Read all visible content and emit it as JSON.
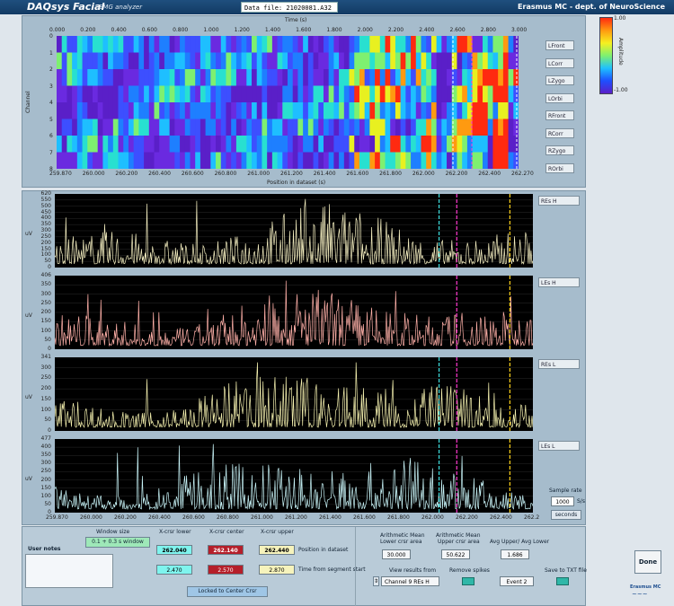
{
  "titlebar": {
    "app_title": "DAQsys Facial",
    "app_subtitle": "EMG analyzer",
    "data_file": "Data file: 21020081.A32",
    "org": "Erasmus MC - dept. of NeuroScience"
  },
  "heatmap": {
    "top_axis_title": "Time (s)",
    "top_ticks": [
      "0.000",
      "0.200",
      "0.400",
      "0.600",
      "0.800",
      "1.000",
      "1.200",
      "1.400",
      "1.600",
      "1.800",
      "2.000",
      "2.200",
      "2.400",
      "2.600",
      "2.800",
      "3.000"
    ],
    "bottom_axis_title": "Position in dataset (s)",
    "bottom_ticks": [
      "259.870",
      "260.000",
      "260.200",
      "260.400",
      "260.600",
      "260.800",
      "261.000",
      "261.200",
      "261.400",
      "261.600",
      "261.800",
      "262.000",
      "262.200",
      "262.400",
      "262.270"
    ],
    "y_axis_title": "Channel",
    "y_ticks": [
      "0",
      "1",
      "2",
      "3",
      "4",
      "5",
      "6",
      "7",
      "8"
    ],
    "channel_buttons": [
      "LFront",
      "LCorr",
      "LZygo",
      "LOrbi",
      "RFront",
      "RCorr",
      "RZygo",
      "ROrbi"
    ],
    "colorbar_max": "1.00",
    "colorbar_min": "-1.00",
    "colorbar_label": "Amplitude",
    "colors": {
      "low": "#5a1fc8",
      "mid": "#1e9fff",
      "high": "#ff2a10"
    }
  },
  "chart_data": [
    {
      "type": "line",
      "name_button": "REs H",
      "y_label": "uV",
      "ylim": [
        0,
        620
      ],
      "y_ticks": [
        "0",
        "50",
        "100",
        "150",
        "200",
        "250",
        "300",
        "350",
        "400",
        "450",
        "500",
        "550",
        "620"
      ],
      "color": "#f4eec0",
      "cursors": [
        {
          "x": 262.04,
          "color": "#3ee0e0"
        },
        {
          "x": 262.14,
          "color": "#ff3ad0"
        },
        {
          "x": 262.44,
          "color": "#ffd21a"
        }
      ]
    },
    {
      "type": "line",
      "name_button": "LEs H",
      "y_label": "uV",
      "ylim": [
        0,
        406
      ],
      "y_ticks": [
        "0",
        "50",
        "100",
        "150",
        "200",
        "250",
        "300",
        "350",
        "406"
      ],
      "color": "#ffb0a8",
      "cursors": [
        {
          "x": 262.14,
          "color": "#ff3ad0"
        },
        {
          "x": 262.44,
          "color": "#ffd21a"
        }
      ]
    },
    {
      "type": "line",
      "name_button": "REs L",
      "y_label": "uV",
      "ylim": [
        0,
        341
      ],
      "y_ticks": [
        "0",
        "50",
        "100",
        "150",
        "200",
        "250",
        "300",
        "341"
      ],
      "color": "#f6f2b0",
      "cursors": [
        {
          "x": 262.04,
          "color": "#3ee0e0"
        },
        {
          "x": 262.14,
          "color": "#ff3ad0"
        },
        {
          "x": 262.44,
          "color": "#ffd21a"
        }
      ]
    },
    {
      "type": "line",
      "name_button": "LEs L",
      "y_label": "uV",
      "ylim": [
        0,
        477
      ],
      "y_ticks": [
        "0",
        "50",
        "100",
        "150",
        "200",
        "250",
        "300",
        "350",
        "400",
        "477"
      ],
      "color": "#c8f4f8",
      "x_ticks": [
        "259.870",
        "260.000",
        "260.200",
        "260.400",
        "260.600",
        "260.800",
        "261.000",
        "261.200",
        "261.400",
        "261.600",
        "261.800",
        "262.000",
        "262.200",
        "262.400",
        "262.2"
      ],
      "cursors": [
        {
          "x": 262.04,
          "color": "#3ee0e0"
        },
        {
          "x": 262.14,
          "color": "#ff3ad0"
        },
        {
          "x": 262.44,
          "color": "#ffd21a"
        }
      ]
    }
  ],
  "sample_rate": {
    "label": "Sample rate",
    "value": "1000",
    "unit": "S/s",
    "seconds_label": "seconds"
  },
  "controls": {
    "window_size_label": "Window size",
    "window_size_value": "0.1 + 0.3 s window",
    "user_notes_label": "User notes",
    "x_lower_label": "X-crsr lower",
    "x_center_label": "X-crsr center",
    "x_upper_label": "X-crsr upper",
    "x_lower_pos": "262.040",
    "x_center_pos": "262.140",
    "x_upper_pos": "262.440",
    "x_lower_time": "2.470",
    "x_center_time": "2.570",
    "x_upper_time": "2.870",
    "position_label": "Position in dataset",
    "time_label": "Time from segment start",
    "locked_button": "Locked to Center Crsr",
    "mean_lower_label1": "Arithmetic Mean",
    "mean_lower_label2": "Lower crsr area",
    "mean_lower_value": "30.000",
    "mean_upper_label1": "Arithmetic Mean",
    "mean_upper_label2": "Upper crsr area",
    "mean_upper_value": "50.622",
    "avg_ratio_label": "Avg Upper/ Avg Lower",
    "avg_ratio_value": "1.686",
    "view_results_label": "View results from",
    "channel_select": "Channel  9  REs H",
    "remove_spikes_label": "Remove spikes",
    "event_value": "Event 2",
    "save_label": "Save to TXT file",
    "done_button": "Done",
    "logo_text": "Erasmus MC"
  }
}
